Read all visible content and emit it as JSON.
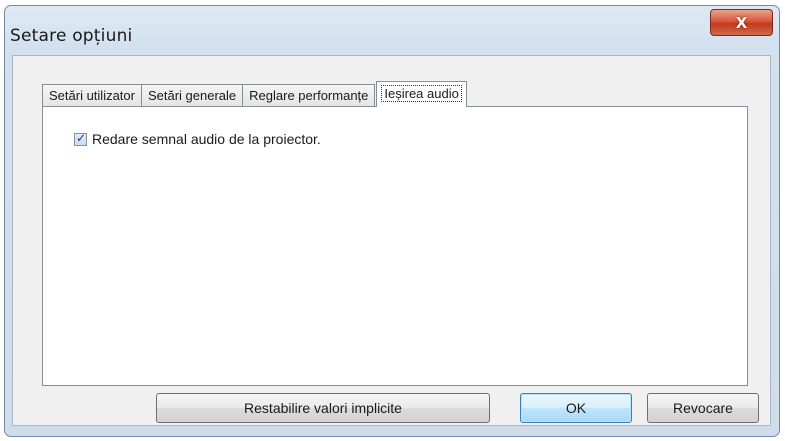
{
  "window": {
    "title": "Setare opțiuni",
    "close_glyph": "X"
  },
  "tabs": [
    {
      "label": "Setări utilizator",
      "active": false
    },
    {
      "label": "Setări generale",
      "active": false
    },
    {
      "label": "Reglare performanțe",
      "active": false
    },
    {
      "label": "Ieșirea audio",
      "active": true
    }
  ],
  "panel": {
    "checkbox_label": "Redare semnal audio de la proiector.",
    "checkbox_checked": true,
    "check_glyph": "✓"
  },
  "buttons": {
    "restore": "Restabilire valori implicite",
    "ok": "OK",
    "cancel": "Revocare"
  },
  "colors": {
    "close_button": "#c23a1c",
    "default_button_border": "#3c7fb1",
    "check_color": "#243a80"
  }
}
